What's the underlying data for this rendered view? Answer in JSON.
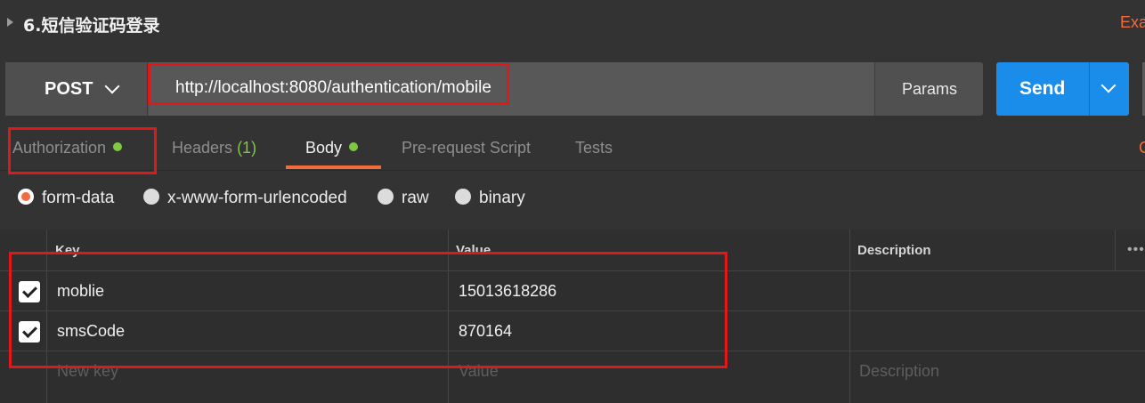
{
  "request": {
    "name": "6.短信验证码登录",
    "examples_label": "Exa",
    "method": "POST",
    "url": "http://localhost:8080/authentication/mobile",
    "params_label": "Params",
    "send_label": "Send"
  },
  "tabs": [
    {
      "label": "Authorization",
      "has_dot": true
    },
    {
      "label": "Headers",
      "count": "(1)"
    },
    {
      "label": "Body",
      "has_dot": true,
      "active": true
    },
    {
      "label": "Pre-request Script"
    },
    {
      "label": "Tests"
    }
  ],
  "tab_edge_text": "C",
  "body_modes": [
    {
      "label": "form-data",
      "selected": true
    },
    {
      "label": "x-www-form-urlencoded"
    },
    {
      "label": "raw"
    },
    {
      "label": "binary"
    }
  ],
  "table": {
    "headers": {
      "key": "Key",
      "value": "Value",
      "description": "Description"
    },
    "more_label": "•••",
    "rows": [
      {
        "checked": true,
        "key": "moblie",
        "value": "15013618286",
        "description": ""
      },
      {
        "checked": true,
        "key": "smsCode",
        "value": "870164",
        "description": ""
      }
    ],
    "placeholder": {
      "key": "New key",
      "value": "Value",
      "description": "Description"
    }
  },
  "colors": {
    "accent_orange": "#f26b3a",
    "send_blue": "#1a8dea",
    "status_green": "#7ec842",
    "highlight_red": "#e01818"
  },
  "icons": [
    "caret-right-icon",
    "chevron-down-icon",
    "more-options-icon",
    "checkbox-checked-icon",
    "radio-icon"
  ]
}
